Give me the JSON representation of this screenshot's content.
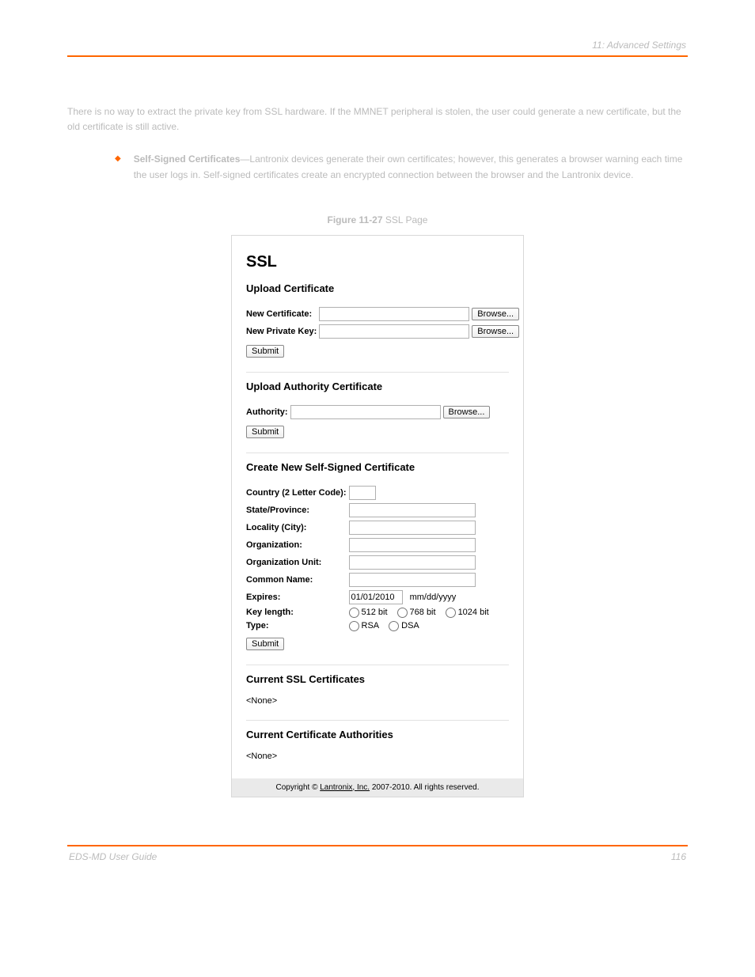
{
  "header": {
    "left": "",
    "right": "11:   Advanced Settings"
  },
  "intro": "There is no way to extract the private key from SSL hardware. If the MMNET peripheral is stolen, the user could generate a new certificate, but the old certificate is still active.",
  "bullet": {
    "heading_bold": "Self-Signed Certificates",
    "text": "—Lantronix devices generate their own certificates; however, this generates a browser warning each time the user logs in. Self-signed certificates create an encrypted connection between the browser and the Lantronix device."
  },
  "figure_caption_label": "Figure 11-27 ",
  "figure_caption_text": "SSL Page",
  "ssl": {
    "title": "SSL",
    "upload_cert": {
      "heading": "Upload Certificate",
      "new_cert_label": "New Certificate:",
      "new_key_label": "New Private Key:",
      "browse": "Browse...",
      "submit": "Submit"
    },
    "upload_auth": {
      "heading": "Upload Authority Certificate",
      "authority_label": "Authority:",
      "browse": "Browse...",
      "submit": "Submit"
    },
    "self_signed": {
      "heading": "Create New Self-Signed Certificate",
      "labels": {
        "country": "Country (2 Letter Code):",
        "state": "State/Province:",
        "locality": "Locality (City):",
        "org": "Organization:",
        "ou": "Organization Unit:",
        "cn": "Common Name:",
        "expires": "Expires:",
        "keylen": "Key length:",
        "type": "Type:"
      },
      "expires_value": "01/01/2010",
      "expires_hint": "mm/dd/yyyy",
      "keylen_opts": [
        "512 bit",
        "768 bit",
        "1024 bit"
      ],
      "type_opts": [
        "RSA",
        "DSA"
      ],
      "submit": "Submit"
    },
    "current_ssl": {
      "heading": "Current SSL Certificates",
      "none": "<None>"
    },
    "current_ca": {
      "heading": "Current Certificate Authorities",
      "none": "<None>"
    },
    "footer": {
      "prefix": "Copyright © ",
      "link": "Lantronix, Inc.",
      "suffix": " 2007-2010. All rights reserved."
    }
  },
  "footer": {
    "left": "EDS-MD User Guide",
    "right": "116"
  }
}
